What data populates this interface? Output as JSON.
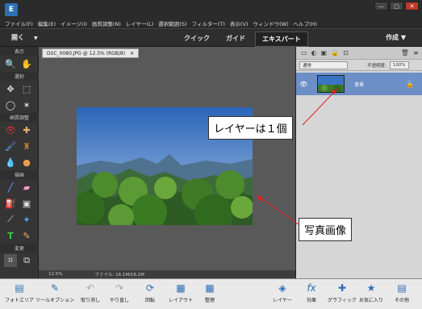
{
  "app": {
    "logo": "E"
  },
  "menu": [
    "ファイル(F)",
    "編集(E)",
    "イメージ(I)",
    "画質調整(N)",
    "レイヤー(L)",
    "選択範囲(S)",
    "フィルター(T)",
    "表示(V)",
    "ウィンドウ(W)",
    "ヘルプ(H)"
  ],
  "window_controls": {
    "minimize": "—",
    "maximize": "□",
    "close": "✕"
  },
  "modebar": {
    "open_label": "開く",
    "tabs": [
      "クイック",
      "ガイド",
      "エキスパート"
    ],
    "active_tab": "エキスパート",
    "create_label": "作成"
  },
  "tools": {
    "sections": [
      {
        "label": "表示",
        "items": [
          "zoom-icon",
          "hand-icon"
        ]
      },
      {
        "label": "選択",
        "items": [
          "move-icon",
          "marquee-icon",
          "lasso-icon",
          "magic-wand-icon"
        ]
      },
      {
        "label": "画質調整",
        "items": [
          "red-eye-icon",
          "spot-heal-icon",
          "smart-brush-icon",
          "clone-stamp-icon",
          "blur-icon",
          "sponge-icon"
        ]
      },
      {
        "label": "描画",
        "items": [
          "brush-icon",
          "eraser-icon",
          "paint-bucket-icon",
          "gradient-icon",
          "eyedropper-icon",
          "shape-icon",
          "type-icon",
          "pencil-icon"
        ]
      },
      {
        "label": "変更",
        "items": [
          "crop-icon",
          "recompose-icon"
        ]
      }
    ]
  },
  "document": {
    "tab_title": "DSC_0080.JPG @ 12.5% (RGB/8)",
    "tab_close": "✕",
    "status_zoom": "12.5%",
    "status_file": "ファイル: 16.1M/16.1M"
  },
  "layers": {
    "blend_mode": "通常",
    "opacity_label": "不透明度:",
    "opacity_value": "100%",
    "layer_name": "背景"
  },
  "bottom": {
    "left": [
      "フォトエリア",
      "ツールオプション",
      "取り消し",
      "やり直し",
      "回転",
      "レイアウト",
      "整理"
    ],
    "right": [
      "レイヤー",
      "効果",
      "グラフィック",
      "お気に入り",
      "その他"
    ]
  },
  "callouts": {
    "layer": "レイヤーは１個",
    "photo": "写真画像"
  },
  "colors": {
    "accent": "#2d6fb4",
    "layer_selected": "#6d8fc7",
    "callout_arrow": "#e02020"
  }
}
